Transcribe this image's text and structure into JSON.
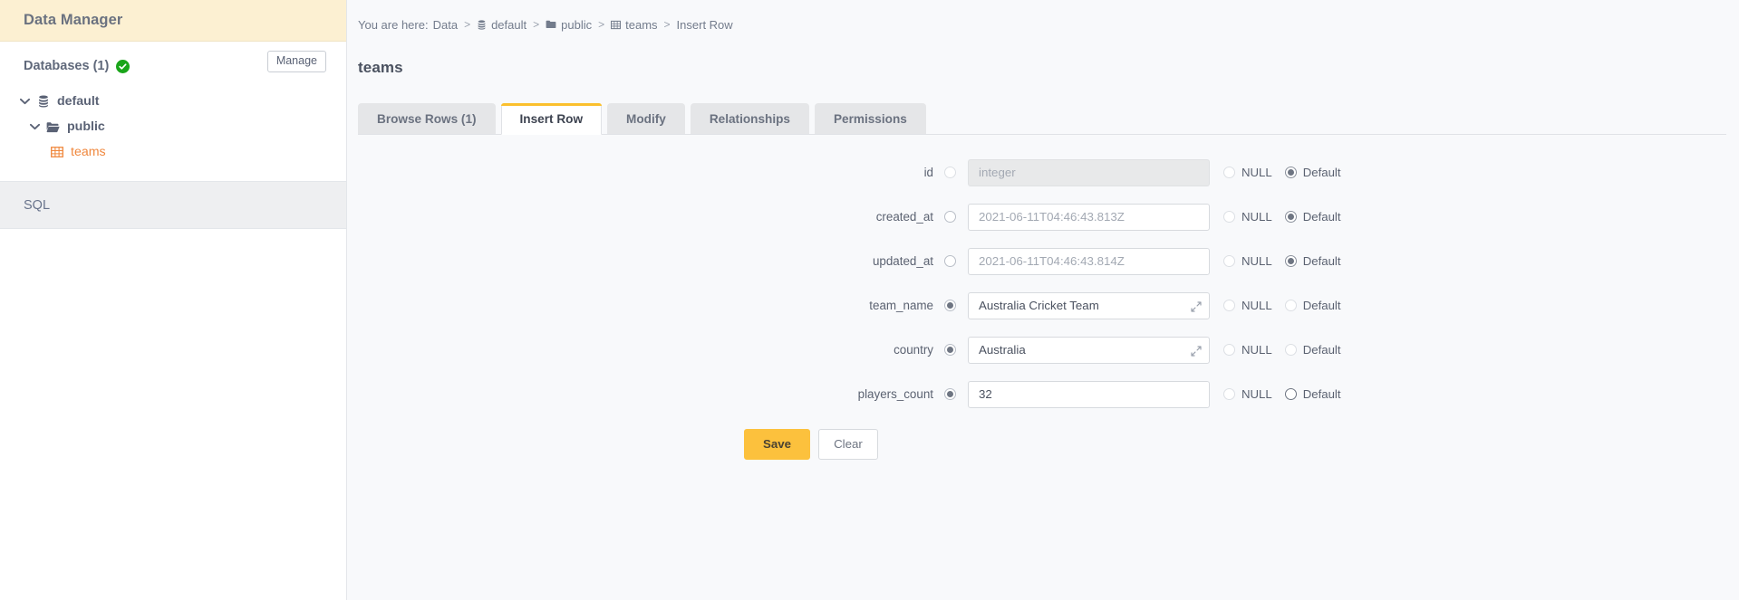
{
  "sidebar": {
    "title": "Data Manager",
    "databases_label": "Databases (1)",
    "status_icon": "check-circle-icon",
    "manage_label": "Manage",
    "tree": [
      {
        "label": "default",
        "icon": "database-icon",
        "level": 1,
        "expanded": true
      },
      {
        "label": "public",
        "icon": "folder-open-icon",
        "level": 2,
        "expanded": true
      },
      {
        "label": "teams",
        "icon": "table-icon",
        "level": 3,
        "expanded": false
      }
    ],
    "sql_label": "SQL"
  },
  "main": {
    "breadcrumb": {
      "prefix": "You are here:",
      "items": [
        {
          "label": "Data",
          "icon": ""
        },
        {
          "label": "default",
          "icon": "database-icon"
        },
        {
          "label": "public",
          "icon": "folder-icon"
        },
        {
          "label": "teams",
          "icon": "table-icon"
        },
        {
          "label": "Insert Row",
          "icon": ""
        }
      ],
      "separator": ">"
    },
    "page_title": "teams",
    "tabs": [
      {
        "label": "Browse Rows (1)",
        "active": false
      },
      {
        "label": "Insert Row",
        "active": true
      },
      {
        "label": "Modify",
        "active": false
      },
      {
        "label": "Relationships",
        "active": false
      },
      {
        "label": "Permissions",
        "active": false
      }
    ],
    "form": {
      "null_label": "NULL",
      "default_label": "Default",
      "rows": [
        {
          "label": "id",
          "value": "",
          "placeholder": "integer",
          "disabled": true,
          "value_radio": "unchecked-dim",
          "null_radio": "unchecked-dim",
          "default_radio": "checked",
          "expandable": false
        },
        {
          "label": "created_at",
          "value": "",
          "placeholder": "2021-06-11T04:46:43.813Z",
          "disabled": false,
          "value_radio": "unchecked",
          "null_radio": "unchecked-dim",
          "default_radio": "checked",
          "expandable": false
        },
        {
          "label": "updated_at",
          "value": "",
          "placeholder": "2021-06-11T04:46:43.814Z",
          "disabled": false,
          "value_radio": "unchecked",
          "null_radio": "unchecked-dim",
          "default_radio": "checked",
          "expandable": false
        },
        {
          "label": "team_name",
          "value": "Australia Cricket Team",
          "placeholder": "",
          "disabled": false,
          "value_radio": "checked",
          "null_radio": "unchecked-dim",
          "default_radio": "unchecked-dim",
          "expandable": true
        },
        {
          "label": "country",
          "value": "Australia",
          "placeholder": "",
          "disabled": false,
          "value_radio": "checked",
          "null_radio": "unchecked-dim",
          "default_radio": "unchecked-dim",
          "expandable": true
        },
        {
          "label": "players_count",
          "value": "32",
          "placeholder": "",
          "disabled": false,
          "value_radio": "checked",
          "null_radio": "unchecked-dim",
          "default_radio": "unchecked",
          "expandable": false
        }
      ],
      "save_label": "Save",
      "clear_label": "Clear"
    }
  },
  "colors": {
    "header_bg": "#fcf0d2",
    "accent": "#fbc02d",
    "save_bg": "#fcc13d",
    "table_orange": "#f0883e",
    "status_green": "#1aa51a",
    "main_bg": "#f8f9fb"
  }
}
